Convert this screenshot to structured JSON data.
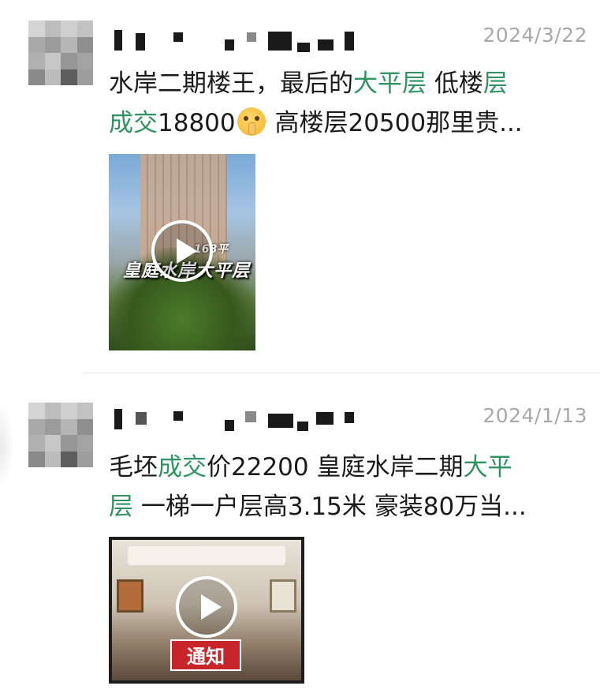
{
  "posts": [
    {
      "date": "2024/3/22",
      "text_segments": [
        {
          "text": "水岸二期楼王，最后的",
          "highlight": false
        },
        {
          "text": "大平层",
          "highlight": true
        },
        {
          "text": " 低楼",
          "highlight": false
        },
        {
          "text": "层\n成交",
          "highlight": true
        },
        {
          "text": "18800",
          "highlight": false
        },
        {
          "text": "[emoji]",
          "highlight": false,
          "emoji": "shushing-face-icon"
        },
        {
          "text": " 高楼层20500那里贵...",
          "highlight": false
        }
      ],
      "video_caption": "皇庭水岸大平层",
      "video_subcaption": "168平"
    },
    {
      "date": "2024/1/13",
      "text_segments": [
        {
          "text": "毛坯",
          "highlight": false
        },
        {
          "text": "成交",
          "highlight": true
        },
        {
          "text": "价22200 皇庭水岸二期",
          "highlight": false
        },
        {
          "text": "大平\n层",
          "highlight": true
        },
        {
          "text": " 一梯一户层高3.15米 豪装80万当...",
          "highlight": false
        }
      ],
      "video_caption": "通知"
    }
  ],
  "colors": {
    "highlight": "#2f9461",
    "text": "#1b1b1b",
    "date": "#a8a8a8"
  }
}
